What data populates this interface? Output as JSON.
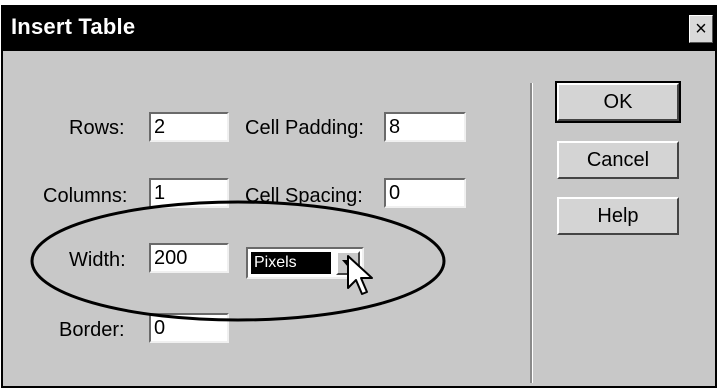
{
  "dialog": {
    "title": "Insert Table",
    "close_glyph": "×"
  },
  "form": {
    "rows": {
      "label": "Rows:",
      "value": "2"
    },
    "columns": {
      "label": "Columns:",
      "value": "1"
    },
    "width": {
      "label": "Width:",
      "value": "200",
      "unit": "Pixels"
    },
    "border": {
      "label": "Border:",
      "value": "0"
    },
    "cell_padding": {
      "label": "Cell Padding:",
      "value": "8"
    },
    "cell_spacing": {
      "label": "Cell Spacing:",
      "value": "0"
    }
  },
  "buttons": {
    "ok": "OK",
    "cancel": "Cancel",
    "help": "Help"
  },
  "icons": {
    "cursor": "arrow-cursor-icon",
    "dropdown": "chevron-down-icon",
    "close": "close-icon"
  },
  "colors": {
    "titlebar": "#000000",
    "dialog_bg": "#c8c8c8",
    "field_bg": "#ffffff"
  }
}
